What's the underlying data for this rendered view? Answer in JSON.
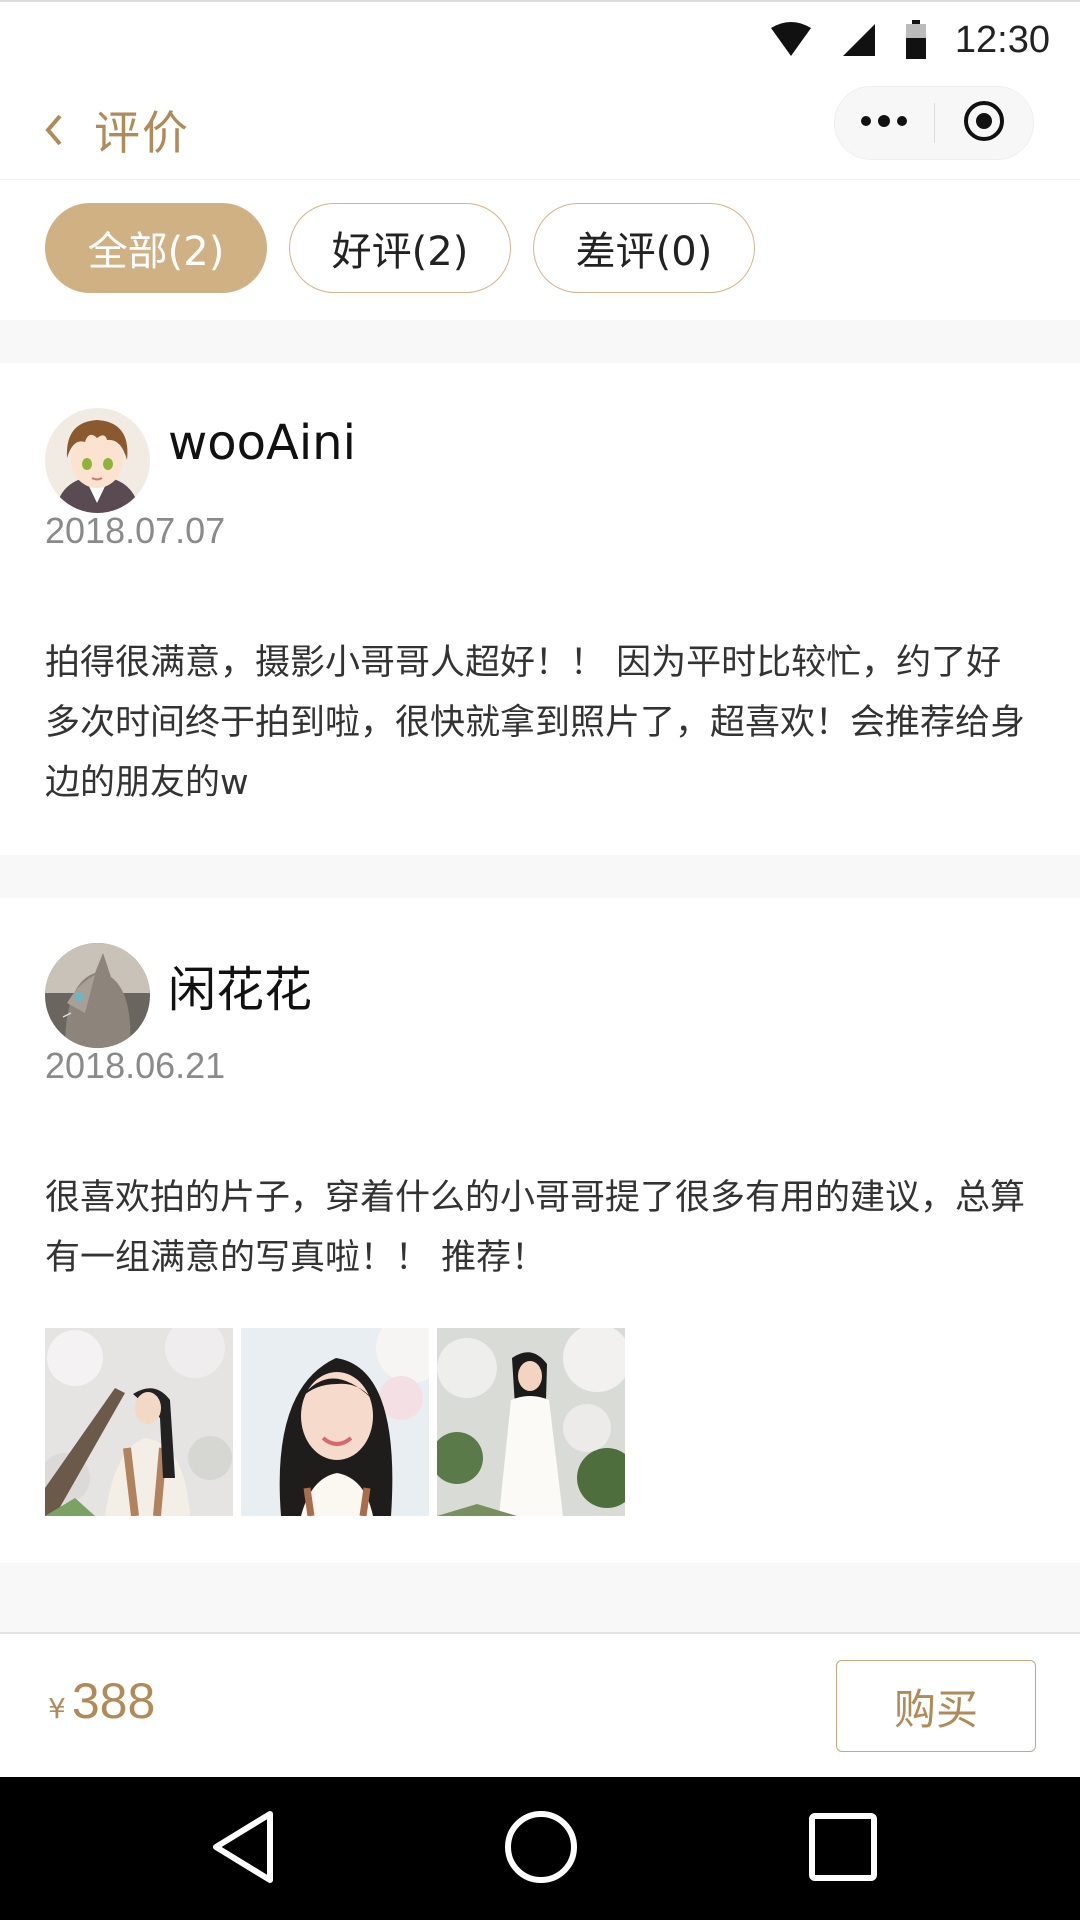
{
  "status_bar": {
    "time": "12:30",
    "icons": [
      "wifi-icon",
      "signal-icon",
      "battery-icon"
    ]
  },
  "nav": {
    "title": "评价",
    "back_icon": "chevron-left-icon",
    "more_icon": "more-dots-icon",
    "close_icon": "target-circle-icon"
  },
  "filters": [
    {
      "label": "全部(2)",
      "active": true
    },
    {
      "label": "好评(2)",
      "active": false
    },
    {
      "label": "差评(0)",
      "active": false
    }
  ],
  "reviews": [
    {
      "username": "wooAini",
      "date": "2018.07.07",
      "text": "拍得很满意，摄影小哥哥人超好！！ 因为平时比较忙，约了好多次时间终于拍到啦，很快就拿到照片了，超喜欢！会推荐给身边的朋友的w",
      "photos": []
    },
    {
      "username": "闲花花",
      "date": "2018.06.21",
      "text": "很喜欢拍的片子，穿着什么的小哥哥提了很多有用的建议，总算有一组满意的写真啦！！ 推荐！",
      "photos": [
        "photo-1",
        "photo-2",
        "photo-3"
      ]
    }
  ],
  "bottom": {
    "currency": "¥",
    "price": "388",
    "buy_label": "购买"
  },
  "colors": {
    "accent": "#b08a57",
    "chip_active": "#cfb183",
    "gap": "#f8f8f8"
  }
}
